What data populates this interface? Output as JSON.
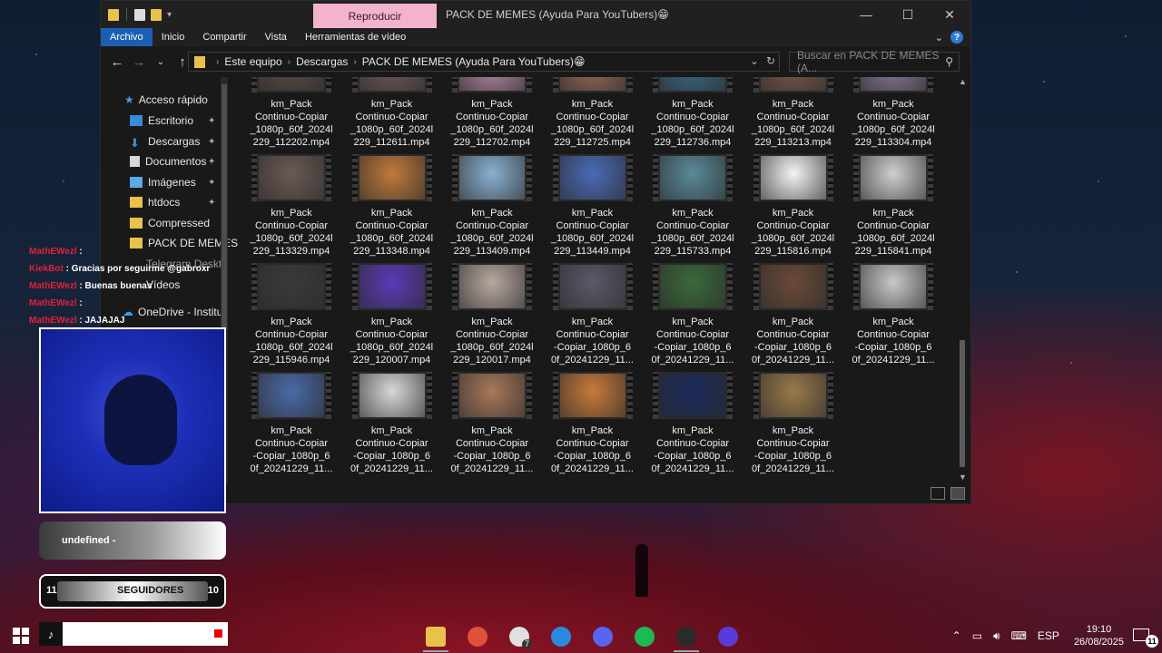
{
  "window": {
    "title": "PACK DE MEMES (Ayuda Para YouTubers)😁",
    "context_tab": "Reproducir",
    "ribbon_tabs": [
      "Archivo",
      "Inicio",
      "Compartir",
      "Vista",
      "Herramientas de vídeo"
    ],
    "help": "?"
  },
  "address": {
    "crumbs": [
      "Este equipo",
      "Descargas",
      "PACK DE MEMES (Ayuda Para YouTubers)😁"
    ],
    "search_placeholder": "Buscar en PACK DE MEMES (A..."
  },
  "nav": {
    "items": [
      {
        "label": "Acceso rápido",
        "icon": "star-icon",
        "pinned": false
      },
      {
        "label": "Escritorio",
        "icon": "desktop-icon",
        "pinned": true
      },
      {
        "label": "Descargas",
        "icon": "download-icon",
        "pinned": true
      },
      {
        "label": "Documentos",
        "icon": "document-icon",
        "pinned": true
      },
      {
        "label": "Imágenes",
        "icon": "image-icon",
        "pinned": true
      },
      {
        "label": "htdocs",
        "icon": "folder-icon",
        "pinned": true
      },
      {
        "label": "Compressed",
        "icon": "folder-icon",
        "pinned": false
      },
      {
        "label": "PACK DE MEMES",
        "icon": "folder-icon",
        "pinned": false
      },
      {
        "label": "Telegram Deskto",
        "icon": "folder-icon",
        "pinned": false
      },
      {
        "label": "Vídeos",
        "icon": "folder-icon",
        "pinned": false
      },
      {
        "label": "OneDrive - Institu",
        "icon": "cloud-icon",
        "pinned": false
      }
    ]
  },
  "files": [
    {
      "l1": "km_Pack",
      "l2": "Continuo-Copiar",
      "l3": "_1080p_60f_2024l",
      "l4": "229_112202.mp4",
      "c": "#5a4a44"
    },
    {
      "l1": "km_Pack",
      "l2": "Continuo-Copiar",
      "l3": "_1080p_60f_2024l",
      "l4": "229_112611.mp4",
      "c": "#6d5a58"
    },
    {
      "l1": "km_Pack",
      "l2": "Continuo-Copiar",
      "l3": "_1080p_60f_2024l",
      "l4": "229_112702.mp4",
      "c": "#b88aa8"
    },
    {
      "l1": "km_Pack",
      "l2": "Continuo-Copiar",
      "l3": "_1080p_60f_2024l",
      "l4": "229_112725.mp4",
      "c": "#9a6a58"
    },
    {
      "l1": "km_Pack",
      "l2": "Continuo-Copiar",
      "l3": "_1080p_60f_2024l",
      "l4": "229_112736.mp4",
      "c": "#3a6a88"
    },
    {
      "l1": "km_Pack",
      "l2": "Continuo-Copiar",
      "l3": "_1080p_60f_2024l",
      "l4": "229_113213.mp4",
      "c": "#7a5a4a"
    },
    {
      "l1": "km_Pack",
      "l2": "Continuo-Copiar",
      "l3": "_1080p_60f_2024l",
      "l4": "229_113304.mp4",
      "c": "#8a7a9a"
    },
    {
      "l1": "km_Pack",
      "l2": "Continuo-Copiar",
      "l3": "_1080p_60f_2024l",
      "l4": "229_113329.mp4",
      "c": "#6a5a54"
    },
    {
      "l1": "km_Pack",
      "l2": "Continuo-Copiar",
      "l3": "_1080p_60f_2024l",
      "l4": "229_113348.mp4",
      "c": "#c07a3a"
    },
    {
      "l1": "km_Pack",
      "l2": "Continuo-Copiar",
      "l3": "_1080p_60f_2024l",
      "l4": "229_113409.mp4",
      "c": "#8ab0d0"
    },
    {
      "l1": "km_Pack",
      "l2": "Continuo-Copiar",
      "l3": "_1080p_60f_2024l",
      "l4": "229_113449.mp4",
      "c": "#4a6ab8"
    },
    {
      "l1": "km_Pack",
      "l2": "Continuo-Copiar",
      "l3": "_1080p_60f_2024l",
      "l4": "229_115733.mp4",
      "c": "#5a8a9a"
    },
    {
      "l1": "km_Pack",
      "l2": "Continuo-Copiar",
      "l3": "_1080p_60f_2024l",
      "l4": "229_115816.mp4",
      "c": "#f4f4f4"
    },
    {
      "l1": "km_Pack",
      "l2": "Continuo-Copiar",
      "l3": "_1080p_60f_2024l",
      "l4": "229_115841.mp4",
      "c": "#cfcfcf"
    },
    {
      "l1": "km_Pack",
      "l2": "Continuo-Copiar",
      "l3": "_1080p_60f_2024l",
      "l4": "229_115946.mp4",
      "c": "#3a3a3a"
    },
    {
      "l1": "km_Pack",
      "l2": "Continuo-Copiar",
      "l3": "_1080p_60f_2024l",
      "l4": "229_120007.mp4",
      "c": "#5a3ab8"
    },
    {
      "l1": "km_Pack",
      "l2": "Continuo-Copiar",
      "l3": "_1080p_60f_2024l",
      "l4": "229_120017.mp4",
      "c": "#b8a8a0"
    },
    {
      "l1": "km_Pack",
      "l2": "Continuo-Copiar",
      "l3": "-Copiar_1080p_6",
      "l4": "0f_20241229_11...",
      "c": "#5a5a6a"
    },
    {
      "l1": "km_Pack",
      "l2": "Continuo-Copiar",
      "l3": "-Copiar_1080p_6",
      "l4": "0f_20241229_11...",
      "c": "#3a6a3a"
    },
    {
      "l1": "km_Pack",
      "l2": "Continuo-Copiar",
      "l3": "-Copiar_1080p_6",
      "l4": "0f_20241229_11...",
      "c": "#6a4a38"
    },
    {
      "l1": "km_Pack",
      "l2": "Continuo-Copiar",
      "l3": "-Copiar_1080p_6",
      "l4": "0f_20241229_11...",
      "c": "#c8c8c8"
    },
    {
      "l1": "km_Pack",
      "l2": "Continuo-Copiar",
      "l3": "-Copiar_1080p_6",
      "l4": "0f_20241229_11...",
      "c": "#4a6aa8"
    },
    {
      "l1": "km_Pack",
      "l2": "Continuo-Copiar",
      "l3": "-Copiar_1080p_6",
      "l4": "0f_20241229_11...",
      "c": "#d8d8d8"
    },
    {
      "l1": "km_Pack",
      "l2": "Continuo-Copiar",
      "l3": "-Copiar_1080p_6",
      "l4": "0f_20241229_11...",
      "c": "#a8785a"
    },
    {
      "l1": "km_Pack",
      "l2": "Continuo-Copiar",
      "l3": "-Copiar_1080p_6",
      "l4": "0f_20241229_11...",
      "c": "#c87a3a"
    },
    {
      "l1": "km_Pack",
      "l2": "Continuo-Copiar",
      "l3": "-Copiar_1080p_6",
      "l4": "0f_20241229_11...",
      "c": "#1a2a5a"
    },
    {
      "l1": "km_Pack",
      "l2": "Continuo-Copiar",
      "l3": "-Copiar_1080p_6",
      "l4": "0f_20241229_11...",
      "c": "#9a7a4a"
    }
  ],
  "chat": [
    {
      "user": "MathEWezl",
      "msg": ""
    },
    {
      "user": "KiekBot",
      "msg": "Gracias por seguirme @gabroxr"
    },
    {
      "user": "MathEWezl",
      "msg": "Buenas buenas"
    },
    {
      "user": "MathEWezl",
      "msg": ""
    },
    {
      "user": "MathEWezl",
      "msg": "JAJAJAJ"
    }
  ],
  "overlay": {
    "now_playing": "undefined -",
    "followers_label": "SEGUIDORES",
    "followers_current": "11",
    "followers_goal": "10",
    "tiktok": "♪"
  },
  "taskbar": {
    "apps": [
      {
        "name": "file-explorer-icon",
        "color": "#e8c24a"
      },
      {
        "name": "brave-icon",
        "color": "#e0513a"
      },
      {
        "name": "whatsapp-icon",
        "color": "#e0e0e0"
      },
      {
        "name": "app-diamond-icon",
        "color": "#2a8ae0"
      },
      {
        "name": "discord-icon",
        "color": "#5865f2"
      },
      {
        "name": "spotify-icon",
        "color": "#1db954"
      },
      {
        "name": "obs-icon",
        "color": "#2a2a2a"
      },
      {
        "name": "app-circle-icon",
        "color": "#5a3ad8"
      }
    ],
    "badge_whatsapp": "7",
    "lang": "ESP",
    "time": "19:10",
    "date": "26/08/2025",
    "notifications": "11"
  }
}
